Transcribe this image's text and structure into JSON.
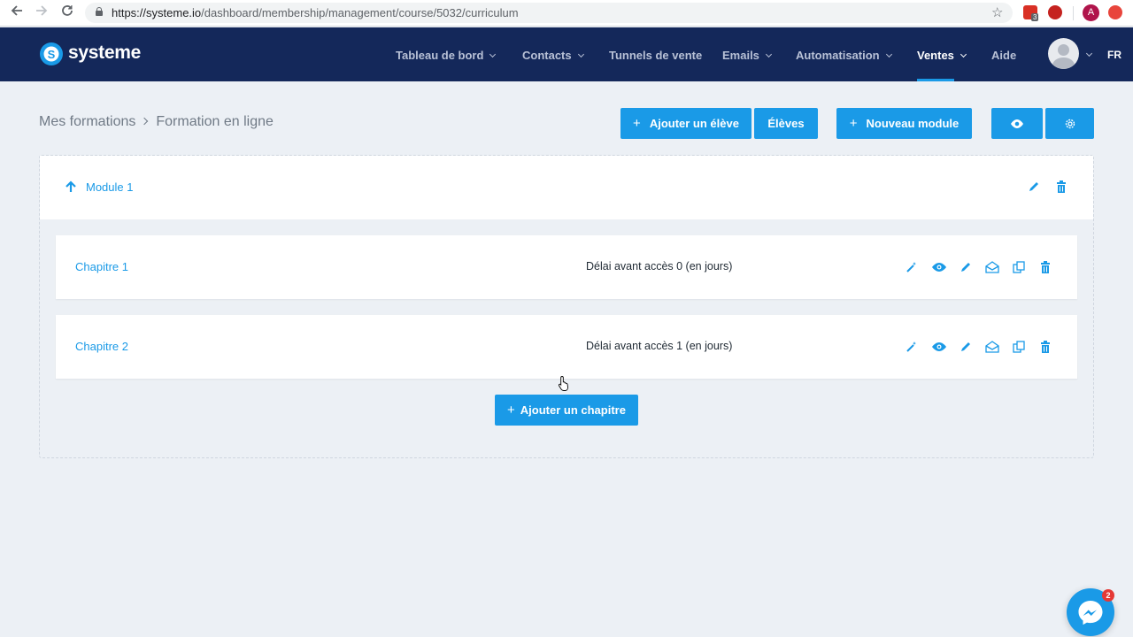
{
  "browser": {
    "url_host": "https://systeme.io",
    "url_path": "/dashboard/membership/management/course/5032/curriculum",
    "extension_badge": "3",
    "profile_initial": "A"
  },
  "header": {
    "brand": "systeme",
    "menu": [
      {
        "label": "Tableau de bord",
        "has_caret": true
      },
      {
        "label": "Contacts",
        "has_caret": true
      },
      {
        "label": "Tunnels de vente",
        "has_caret": false
      },
      {
        "label": "Emails",
        "has_caret": true
      },
      {
        "label": "Automatisation",
        "has_caret": true
      },
      {
        "label": "Ventes",
        "has_caret": true,
        "active": true
      },
      {
        "label": "Aide",
        "has_caret": false
      }
    ],
    "language": "FR"
  },
  "breadcrumb": {
    "root": "Mes formations",
    "current": "Formation en ligne"
  },
  "toolbar": {
    "add_student": "Ajouter un élève",
    "students": "Élèves",
    "new_module": "Nouveau module"
  },
  "module": {
    "title": "Module 1"
  },
  "chapters": [
    {
      "title": "Chapitre 1",
      "delay": "Délai avant accès 0 (en jours)"
    },
    {
      "title": "Chapitre 2",
      "delay": "Délai avant accès 1 (en jours)"
    }
  ],
  "add_chapter_label": "Ajouter un chapitre",
  "messenger_badge": "2",
  "colors": {
    "accent": "#1a9ae7",
    "header_bg": "#14285a",
    "page_bg": "#ecf0f5"
  }
}
